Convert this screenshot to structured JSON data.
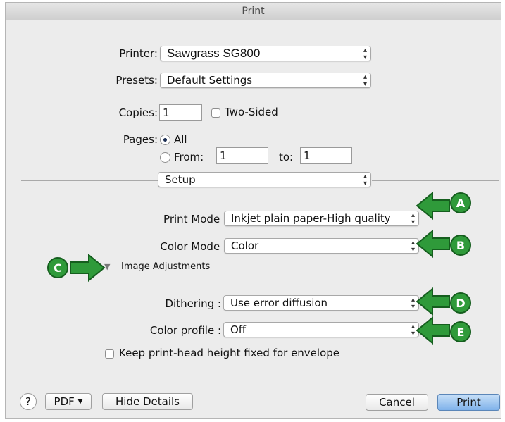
{
  "window": {
    "title": "Print"
  },
  "printer": {
    "label": "Printer:",
    "value": "Sawgrass SG800"
  },
  "presets": {
    "label": "Presets:",
    "value": "Default Settings"
  },
  "copies": {
    "label": "Copies:",
    "value": "1",
    "two_sided_label": "Two-Sided",
    "two_sided_checked": false
  },
  "pages": {
    "label": "Pages:",
    "all_label": "All",
    "from_label": "From:",
    "from_value": "1",
    "to_label": "to:",
    "to_value": "1",
    "selected": "All"
  },
  "section": {
    "value": "Setup"
  },
  "print_mode": {
    "label": "Print Mode :",
    "value": "Inkjet plain paper-High quality"
  },
  "color_mode": {
    "label": "Color Mode :",
    "value": "Color"
  },
  "image_adjustments": {
    "label": "Image Adjustments",
    "expanded": false
  },
  "dithering": {
    "label": "Dithering :",
    "value": "Use error diffusion"
  },
  "color_profile": {
    "label": "Color profile :",
    "value": "Off"
  },
  "envelope": {
    "label": "Keep print-head height fixed for envelope",
    "checked": false
  },
  "footer": {
    "help": "?",
    "pdf": "PDF",
    "hide_details": "Hide Details",
    "cancel": "Cancel",
    "print": "Print"
  },
  "callouts": {
    "a": "A",
    "b": "B",
    "c": "C",
    "d": "D",
    "e": "E"
  },
  "colors": {
    "callout_green": "#2f9a3a",
    "window_bg": "#ececec",
    "primary_button": "#7fb2ea"
  },
  "icons": {
    "popup_arrows": "updown-arrows-icon",
    "disclosure": "disclosure-triangle-icon"
  }
}
